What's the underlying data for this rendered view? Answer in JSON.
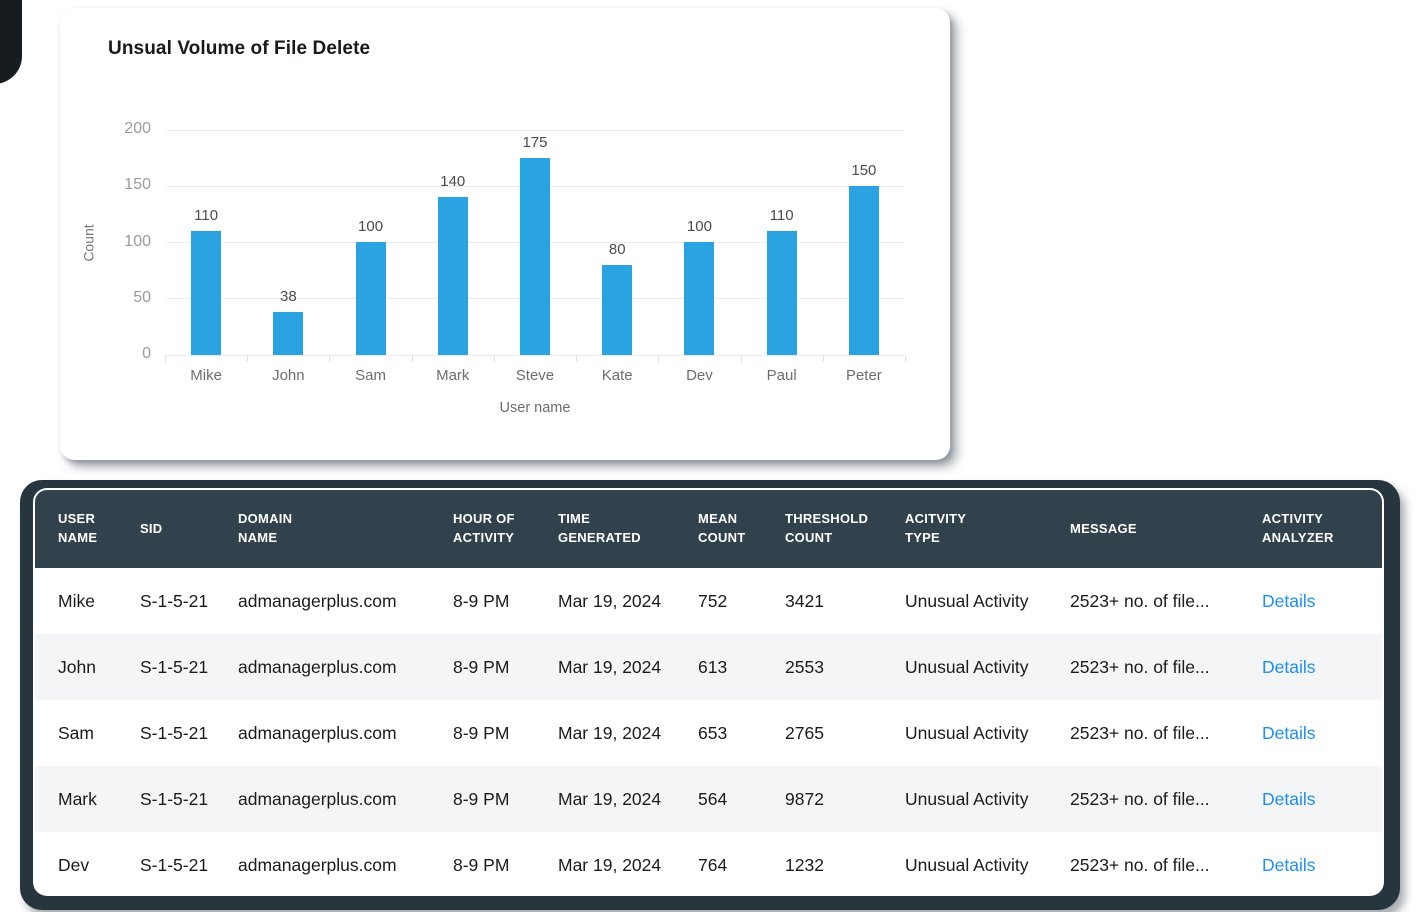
{
  "chart_data": {
    "type": "bar",
    "title": "Unsual Volume of File Delete",
    "categories": [
      "Mike",
      "John",
      "Sam",
      "Mark",
      "Steve",
      "Kate",
      "Dev",
      "Paul",
      "Peter"
    ],
    "values": [
      110,
      38,
      100,
      140,
      175,
      80,
      100,
      110,
      150
    ],
    "xlabel": "User name",
    "ylabel": "Count",
    "ylim": [
      0,
      200
    ],
    "yticks": [
      0,
      50,
      100,
      150,
      200
    ],
    "grid": true,
    "legend": false,
    "value_labels": true,
    "bar_color": "#2AA4E1"
  },
  "table": {
    "columns": [
      {
        "key": "user",
        "label": "USER NAME"
      },
      {
        "key": "sid",
        "label": "SID"
      },
      {
        "key": "domain",
        "label": "DOMAIN NAME"
      },
      {
        "key": "hour",
        "label": "HOUR OF ACTIVITY"
      },
      {
        "key": "time",
        "label": "TIME GENERATED"
      },
      {
        "key": "mean",
        "label": "MEAN COUNT"
      },
      {
        "key": "threshold",
        "label": "THRESHOLD COUNT"
      },
      {
        "key": "type",
        "label": "ACITVITY TYPE"
      },
      {
        "key": "message",
        "label": "MESSAGE"
      },
      {
        "key": "analyzer",
        "label": "ACTIVITY ANALYZER"
      }
    ],
    "rows": [
      {
        "user": "Mike",
        "sid": "S-1-5-21",
        "domain": "admanagerplus.com",
        "hour": "8-9 PM",
        "time": "Mar 19, 2024",
        "mean": "752",
        "threshold": "3421",
        "type": "Unusual Activity",
        "message": "2523+ no. of file...",
        "analyzer": "Details"
      },
      {
        "user": "John",
        "sid": "S-1-5-21",
        "domain": "admanagerplus.com",
        "hour": "8-9 PM",
        "time": "Mar 19, 2024",
        "mean": "613",
        "threshold": "2553",
        "type": "Unusual Activity",
        "message": "2523+ no. of file...",
        "analyzer": "Details"
      },
      {
        "user": "Sam",
        "sid": "S-1-5-21",
        "domain": "admanagerplus.com",
        "hour": "8-9 PM",
        "time": "Mar 19, 2024",
        "mean": "653",
        "threshold": "2765",
        "type": "Unusual Activity",
        "message": "2523+ no. of file...",
        "analyzer": "Details"
      },
      {
        "user": "Mark",
        "sid": "S-1-5-21",
        "domain": "admanagerplus.com",
        "hour": "8-9 PM",
        "time": "Mar 19, 2024",
        "mean": "564",
        "threshold": "9872",
        "type": "Unusual Activity",
        "message": "2523+ no. of file...",
        "analyzer": "Details"
      },
      {
        "user": "Dev",
        "sid": "S-1-5-21",
        "domain": "admanagerplus.com",
        "hour": "8-9 PM",
        "time": "Mar 19, 2024",
        "mean": "764",
        "threshold": "1232",
        "type": "Unusual Activity",
        "message": "2523+ no. of file...",
        "analyzer": "Details"
      }
    ]
  },
  "colors": {
    "bar": "#2AA4E1",
    "link": "#1E8FF0",
    "header_bg": "#32424D",
    "frame_bg": "#26353E",
    "row_alt": "#F4F5F6"
  }
}
